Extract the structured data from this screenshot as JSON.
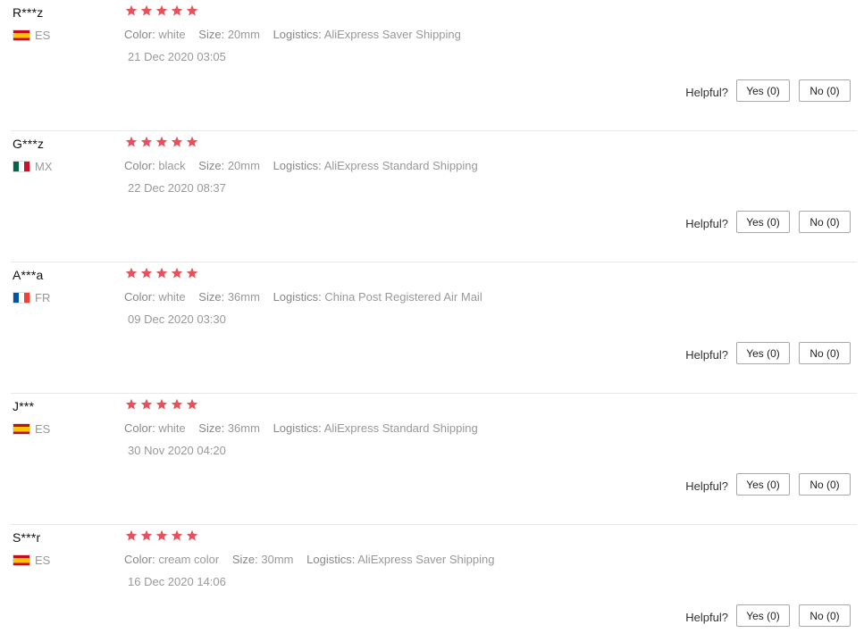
{
  "labels": {
    "color": "Color:",
    "size": "Size:",
    "logistics": "Logistics:",
    "helpful": "Helpful?"
  },
  "colors": {
    "star": "#e8505b",
    "divider": "#e8e8e8"
  },
  "reviews": [
    {
      "user": "R***z",
      "country": "ES",
      "flag": "es",
      "rating": 5,
      "color": "white",
      "size": "20mm",
      "logistics": "AliExpress Saver Shipping",
      "date": "21 Dec 2020 03:05",
      "yes": "Yes (0)",
      "no": "No (0)"
    },
    {
      "user": "G***z",
      "country": "MX",
      "flag": "mx",
      "rating": 5,
      "color": "black",
      "size": "20mm",
      "logistics": "AliExpress Standard Shipping",
      "date": "22 Dec 2020 08:37",
      "yes": "Yes (0)",
      "no": "No (0)"
    },
    {
      "user": "A***a",
      "country": "FR",
      "flag": "fr",
      "rating": 5,
      "color": "white",
      "size": "36mm",
      "logistics": "China Post Registered Air Mail",
      "date": "09 Dec 2020 03:30",
      "yes": "Yes (0)",
      "no": "No (0)"
    },
    {
      "user": "J***",
      "country": "ES",
      "flag": "es",
      "rating": 5,
      "color": "white",
      "size": "36mm",
      "logistics": "AliExpress Standard Shipping",
      "date": "30 Nov 2020 04:20",
      "yes": "Yes (0)",
      "no": "No (0)"
    },
    {
      "user": "S***r",
      "country": "ES",
      "flag": "es",
      "rating": 5,
      "color": "cream color",
      "size": "30mm",
      "logistics": "AliExpress Saver Shipping",
      "date": "16 Dec 2020 14:06",
      "yes": "Yes (0)",
      "no": "No (0)"
    }
  ]
}
